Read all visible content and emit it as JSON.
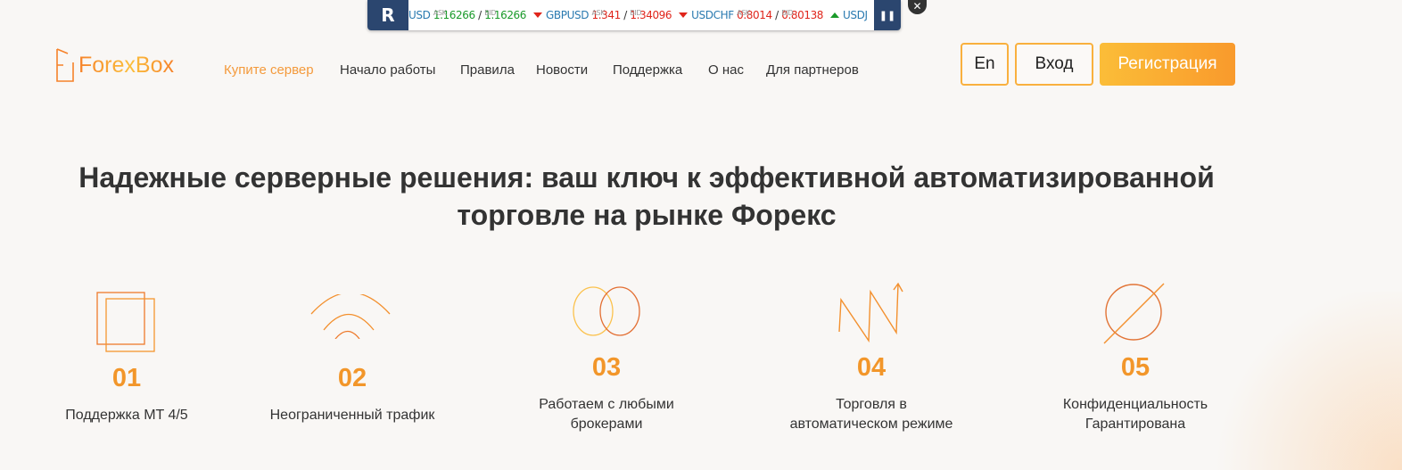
{
  "ticker": {
    "logo": "R",
    "items": [
      {
        "symbol": "USD",
        "ask_label": "ASK",
        "ask": "1.16266",
        "bid_label": "BID",
        "bid": "1.16266",
        "dir": "up"
      },
      {
        "symbol": "GBPUSD",
        "ask_label": "ASK",
        "ask": "1.341",
        "bid_label": "BID",
        "bid": "1.34096",
        "dir": "down"
      },
      {
        "symbol": "USDCHF",
        "ask_label": "ASK",
        "ask": "0.8014",
        "bid_label": "BID",
        "bid": "0.80138",
        "dir": "down"
      },
      {
        "symbol": "USDJ",
        "dir": "up"
      }
    ],
    "separator": "/",
    "pause": "❚❚",
    "close": "✕"
  },
  "header": {
    "logo_text": "ForexBox",
    "nav": [
      "Купите сервер",
      "Начало работы",
      "Правила",
      "Новости",
      "Поддержка",
      "О нас",
      "Для партнеров"
    ],
    "lang_button": "En",
    "login_button": "Вход",
    "register_button": "Регистрация"
  },
  "hero": {
    "title_line1": "Надежные серверные решения: ваш ключ к эффективной автоматизированной",
    "title_line2": "торговле на рынке Форекс"
  },
  "features": [
    {
      "number": "01",
      "label": "Поддержка MT 4/5",
      "icon": "squares-icon"
    },
    {
      "number": "02",
      "label": "Неограниченный трафик",
      "icon": "signal-icon"
    },
    {
      "number": "03",
      "label": "Работаем с любыми брокерами",
      "icon": "circles-icon"
    },
    {
      "number": "04",
      "label": "Торговля в автоматическом режиме",
      "icon": "zigzag-arrow-icon"
    },
    {
      "number": "05",
      "label": "Конфиденциальность Гарантирована",
      "icon": "empty-set-icon"
    }
  ],
  "colors": {
    "accent": "#f2962a",
    "ticker_bg": "#2b466f",
    "up": "#1a9a2a",
    "down": "#e0251b"
  }
}
